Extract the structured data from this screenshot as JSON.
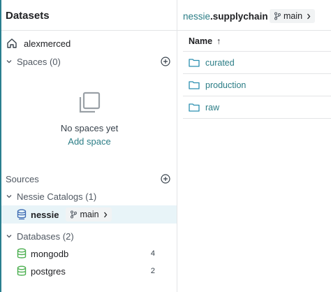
{
  "sidebar": {
    "title": "Datasets",
    "home_label": "alexmerced",
    "spaces": {
      "label": "Spaces (0)"
    },
    "empty_state": {
      "message": "No spaces yet",
      "link": "Add space"
    },
    "sources_label": "Sources",
    "nessie_catalogs": {
      "label": "Nessie Catalogs (1)",
      "items": [
        {
          "label": "nessie",
          "branch": "main"
        }
      ]
    },
    "databases": {
      "label": "Databases (2)",
      "items": [
        {
          "label": "mongodb",
          "count": "4"
        },
        {
          "label": "postgres",
          "count": "2"
        }
      ]
    }
  },
  "main": {
    "breadcrumb": {
      "source": "nessie",
      "separator": ".",
      "folder": "supplychain"
    },
    "branch": "main",
    "table": {
      "header": "Name",
      "sort_indicator": "↑",
      "rows": [
        {
          "name": "curated"
        },
        {
          "name": "production"
        },
        {
          "name": "raw"
        }
      ]
    }
  },
  "colors": {
    "accent": "#2b7d86",
    "folder": "#2b8fb0",
    "db_green": "#4caf50",
    "selected_bg": "#e8f4f8"
  }
}
